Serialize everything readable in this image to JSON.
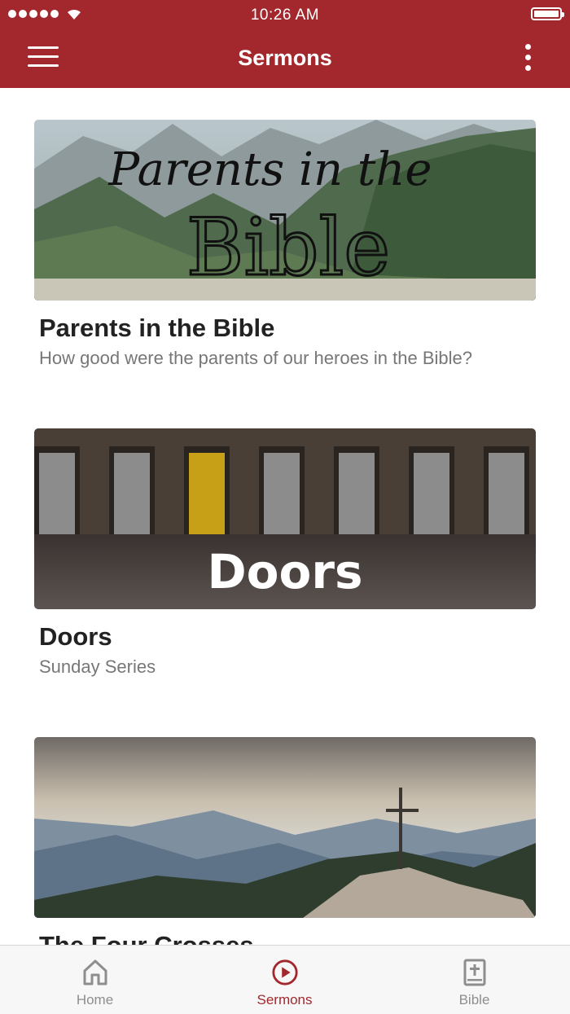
{
  "status_bar": {
    "time": "10:26 AM"
  },
  "header": {
    "title": "Sermons"
  },
  "sermons": [
    {
      "title": "Parents in the Bible",
      "subtitle": "How good were the parents of our heroes in the Bible?",
      "banner_script": "Parents in the",
      "banner_word": "Bible"
    },
    {
      "title": "Doors",
      "subtitle": "Sunday Series",
      "banner_word": "Doors"
    },
    {
      "title": "The Four Crosses",
      "subtitle": ""
    }
  ],
  "tabs": [
    {
      "label": "Home",
      "icon": "home-icon",
      "active": false
    },
    {
      "label": "Sermons",
      "icon": "play-circle-icon",
      "active": true
    },
    {
      "label": "Bible",
      "icon": "bible-icon",
      "active": false
    }
  ],
  "colors": {
    "accent": "#a3282d",
    "inactive": "#8e8e8e"
  }
}
